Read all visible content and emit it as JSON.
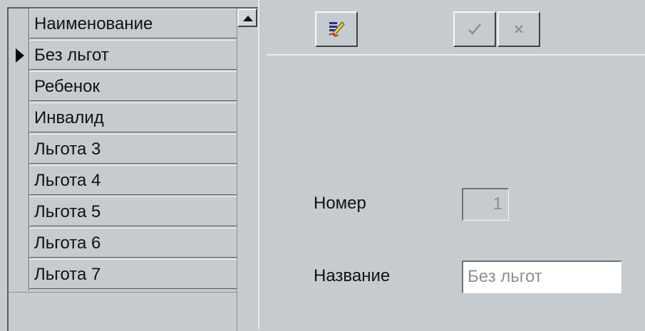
{
  "grid": {
    "header": "Наименование",
    "rows": [
      "Без льгот",
      "Ребенок",
      "Инвалид",
      "Льгота 3",
      "Льгота 4",
      "Льгота 5",
      "Льгота 6",
      "Льгота 7"
    ],
    "current_row_index": 0
  },
  "toolbar": {
    "edit_icon": "edit-record-icon",
    "confirm_icon": "checkmark-icon",
    "cancel_icon": "close-icon"
  },
  "form": {
    "number_label": "Номер",
    "number_value": "1",
    "name_label": "Название",
    "name_value": "Без льгот"
  }
}
